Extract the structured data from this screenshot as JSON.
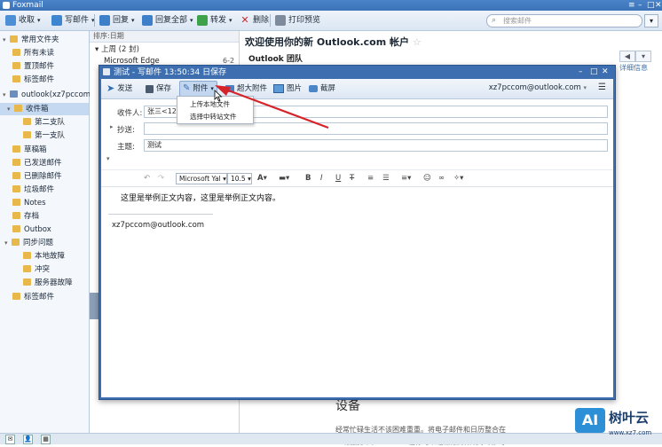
{
  "app": {
    "title": "Foxmail",
    "window_controls": [
      "≡",
      "–",
      "□",
      "✕"
    ]
  },
  "toolbar": {
    "receive": "收取",
    "compose": "写邮件",
    "reply": "回复",
    "reply_all": "回复全部",
    "forward": "转发",
    "delete": "删除",
    "print_preview": "打印预览",
    "search_placeholder": "搜索邮件"
  },
  "folders": {
    "common_header": "常用文件夹",
    "common": [
      "所有未读",
      "置顶邮件",
      "标签邮件"
    ],
    "account": "outlook(xz7pccom)",
    "inbox": "收件箱",
    "inbox_children": [
      "第二支队",
      "第一支队"
    ],
    "other": [
      "草稿箱",
      "已发送邮件",
      "已删除邮件",
      "垃圾邮件",
      "Notes",
      "存档",
      "Outbox"
    ],
    "sync_issues": "同步问题",
    "sync_children": [
      "本地故障",
      "冲突",
      "服务器故障"
    ],
    "tag_mail": "标签邮件"
  },
  "list": {
    "sort_label": "排序:日期",
    "group_label": "上周 (2 封)",
    "rows": [
      {
        "sender": "Microsoft Edge",
        "date": "6-2"
      }
    ]
  },
  "reader": {
    "title": "欢迎使用你的新 Outlook.com 帐户",
    "sender": "Outlook 团队",
    "detail_link": "详细信息",
    "section_heading": "设备",
    "para_line1": "经常忙碌生活不该困难重重。将电子邮件和日历整合在",
    "para_line2": "一切服务中，Outlook 让你可以轻松跟踪所有事项。于"
  },
  "compose": {
    "title": "测试 - 写邮件   13:50:34 日保存",
    "toolbar": {
      "send": "发送",
      "save": "保存",
      "attach": "附件",
      "big_attach": "超大附件",
      "image": "图片",
      "screenshot": "截屏",
      "from": "xz7pccom@outlook.com"
    },
    "fields": {
      "to_label": "收件人:",
      "to_value": "张三<1231",
      "cc_label": "抄送:",
      "subject_label": "主题:",
      "subject_value": "测试"
    },
    "format": {
      "font": "Microsoft Yal",
      "size": "10.5"
    },
    "body": "这里是举例正文内容，这里是举例正文内容。",
    "signature": "xz7pccom@outlook.com"
  },
  "attach_menu": [
    "上传本地文件",
    "选择中转站文件"
  ],
  "watermark": {
    "text": "树叶云",
    "url": "www.xz7.com",
    "badge": "AI"
  },
  "colors": {
    "titlebar": "#3c73b8",
    "selected": "#c5d9f1",
    "arrow": "#d6232a"
  }
}
